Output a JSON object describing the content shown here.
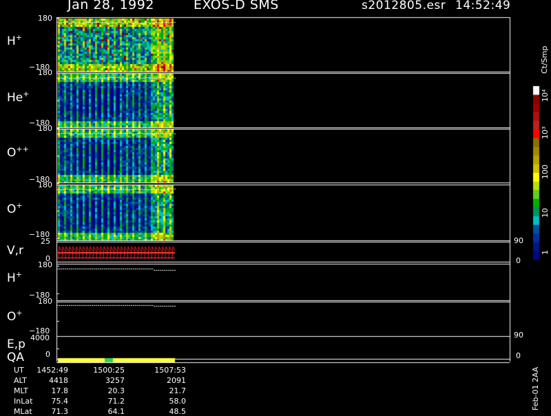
{
  "header": {
    "date": "Jan 28, 1992",
    "instrument": "EXOS-D SMS",
    "file": "s2012805.esr",
    "time": "14:52:49"
  },
  "panels": [
    {
      "base": "H",
      "sup": "+",
      "top_tick": "180",
      "bottom_tick": "−180"
    },
    {
      "base": "He",
      "sup": "+",
      "top_tick": "180",
      "bottom_tick": "−180"
    },
    {
      "base": "O",
      "sup": "++",
      "top_tick": "180",
      "bottom_tick": "−180"
    },
    {
      "base": "O",
      "sup": "+",
      "top_tick": "180",
      "bottom_tick": "−180"
    }
  ],
  "vr_panel": {
    "label": "V,r",
    "top_tick": "25",
    "bottom_tick": "0",
    "right_top": "90",
    "right_bottom": "0"
  },
  "lower_panels": [
    {
      "base": "H",
      "sup": "+",
      "top_tick": "180",
      "bottom_tick": "−180"
    },
    {
      "base": "O",
      "sup": "+",
      "top_tick": "180",
      "bottom_tick": "−180"
    }
  ],
  "ep_panel": {
    "label1": "E,p",
    "label2": "QA",
    "top_tick": "4000",
    "bottom_tick": "0",
    "right_top": "90",
    "right_bottom": "0"
  },
  "colorbar": {
    "unit": "Ct/Smp",
    "ticks": [
      "1",
      "10",
      "100",
      "10³",
      "10⁴"
    ],
    "colors": [
      "#ffffff",
      "#8b0000",
      "#a00000",
      "#b01010",
      "#c02020",
      "#ff0000",
      "#8b7000",
      "#a08a00",
      "#b8a400",
      "#d4c000",
      "#ffff00",
      "#b8e000",
      "#60d020",
      "#00b000",
      "#009060",
      "#00c0c0",
      "#0050a0",
      "#0030a0",
      "#001880",
      "#000880"
    ]
  },
  "chart_data": {
    "type": "heatmap",
    "title": "Jan 28, 1992 EXOS-D SMS",
    "x_ticks": [
      "1452:49",
      "1500:25",
      "1507:53"
    ],
    "panels": [
      "H+",
      "He+",
      "O++",
      "O+"
    ],
    "ylim": [
      -180,
      180
    ],
    "color_scale": "log",
    "color_range": [
      1,
      10000
    ],
    "color_unit": "Ct/Smp"
  },
  "orbit_table": {
    "rows": [
      {
        "label": "UT",
        "values": [
          "1452:49",
          "1500:25",
          "1507:53"
        ]
      },
      {
        "label": "ALT",
        "values": [
          "4418",
          "3257",
          "2091"
        ]
      },
      {
        "label": "MLT",
        "values": [
          "17.8",
          "20.3",
          "21.7"
        ]
      },
      {
        "label": "InLat",
        "values": [
          "75.4",
          "71.2",
          "58.0"
        ]
      },
      {
        "label": "MLat",
        "values": [
          "71.3",
          "64.1",
          "48.5"
        ]
      }
    ]
  },
  "footer_id": "Feb-01 2AA"
}
